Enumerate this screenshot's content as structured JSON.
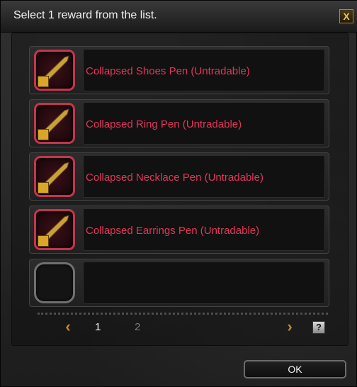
{
  "dialog": {
    "title": "Select 1 reward from the list.",
    "close_label": "X"
  },
  "rewards": [
    {
      "name": "Collapsed Shoes Pen (Untradable)",
      "icon": "pen-icon",
      "color": "#e23658"
    },
    {
      "name": "Collapsed Ring Pen (Untradable)",
      "icon": "pen-icon",
      "color": "#e23658"
    },
    {
      "name": "Collapsed Necklace Pen (Untradable)",
      "icon": "pen-icon",
      "color": "#e23658"
    },
    {
      "name": "Collapsed Earrings Pen (Untradable)",
      "icon": "pen-icon",
      "color": "#e23658"
    },
    {
      "name": "",
      "icon": "empty-slot"
    }
  ],
  "pagination": {
    "prev_icon": "chevron-left-icon",
    "next_icon": "chevron-right-icon",
    "pages": [
      "1",
      "2"
    ],
    "current_page": "1",
    "help_label": "?"
  },
  "footer": {
    "ok_label": "OK"
  },
  "colors": {
    "item_name": "#e23658",
    "slot_border": "#c4354d",
    "arrow": "#c08a2b"
  }
}
